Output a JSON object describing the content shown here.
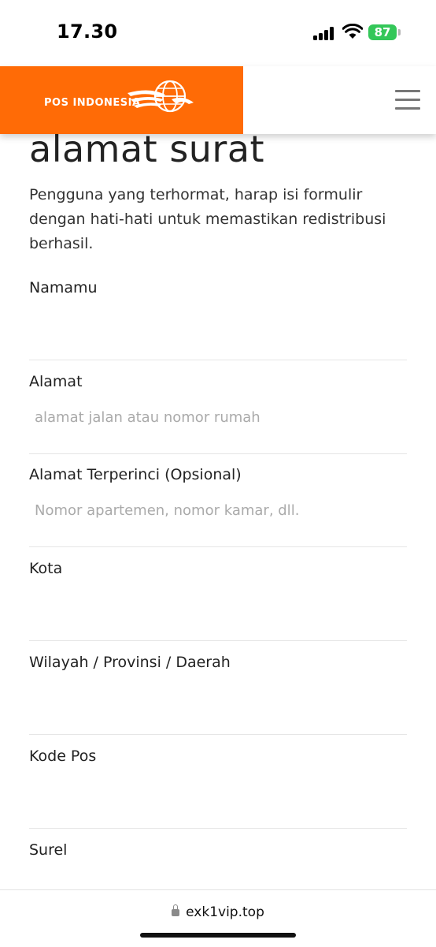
{
  "status_bar": {
    "time": "17.30",
    "battery": "87"
  },
  "header": {
    "logo_text": "POS INDONESIA",
    "brand_color": "#ff6b06"
  },
  "page": {
    "title": "alamat surat",
    "intro": "Pengguna yang terhormat, harap isi formulir dengan hati-hati untuk memastikan redistribusi berhasil."
  },
  "form": {
    "fields": [
      {
        "label": "Namamu",
        "placeholder": ""
      },
      {
        "label": "Alamat",
        "placeholder": "alamat jalan atau nomor rumah"
      },
      {
        "label": "Alamat Terperinci (Opsional)",
        "placeholder": "Nomor apartemen, nomor kamar, dll."
      },
      {
        "label": "Kota",
        "placeholder": ""
      },
      {
        "label": "Wilayah / Provinsi / Daerah",
        "placeholder": ""
      },
      {
        "label": "Kode Pos",
        "placeholder": ""
      },
      {
        "label": "Surel",
        "placeholder": ""
      }
    ]
  },
  "browser": {
    "url": "exk1vip.top"
  }
}
